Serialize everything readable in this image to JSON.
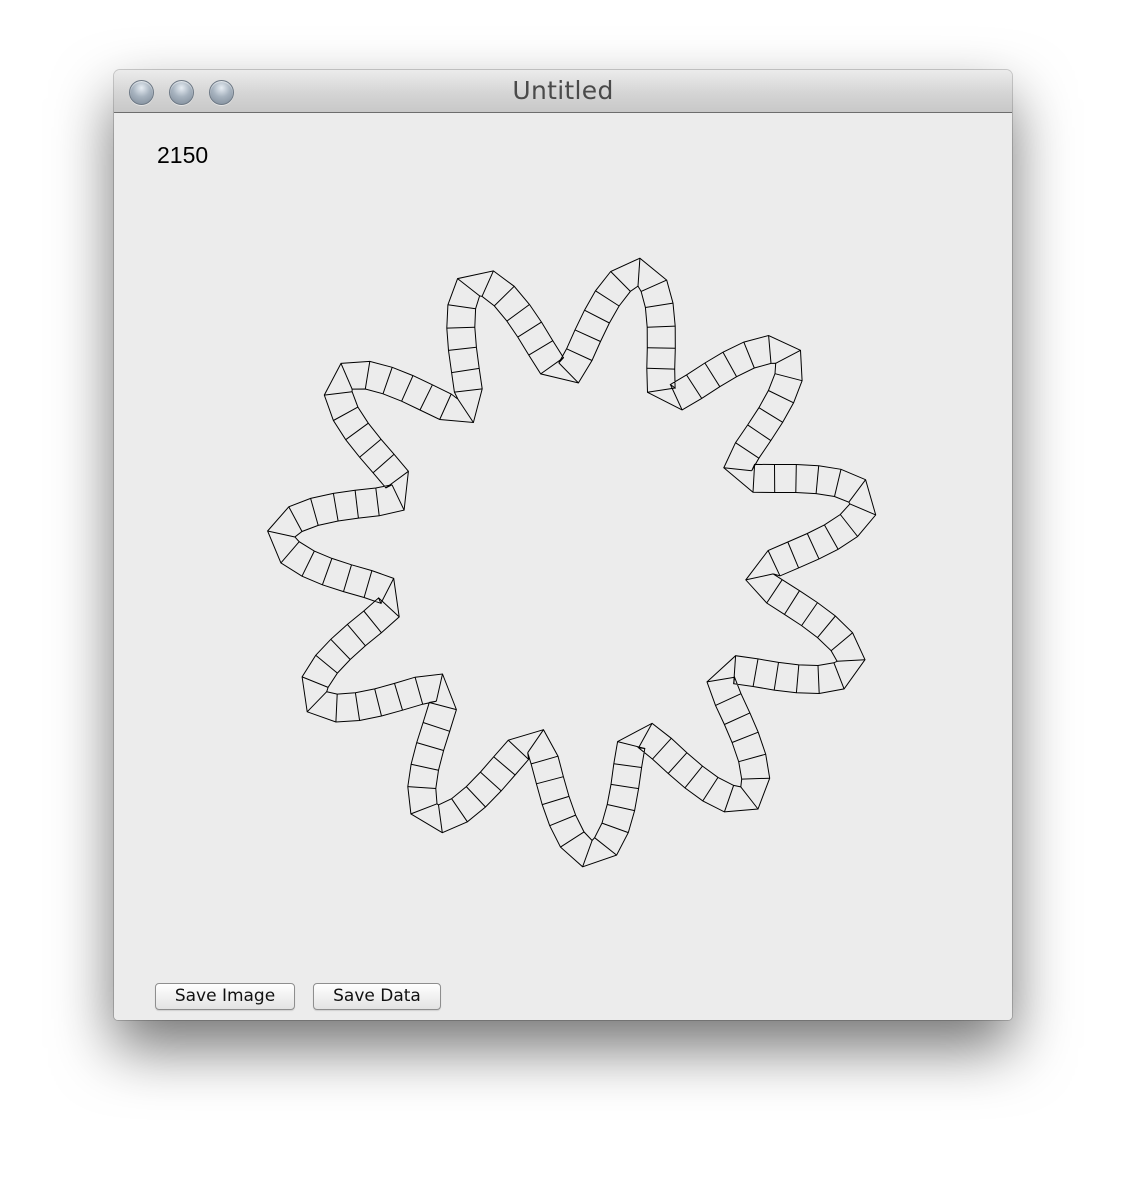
{
  "window": {
    "title": "Untitled"
  },
  "counter": {
    "value": "2150"
  },
  "buttons": {
    "save_image": "Save Image",
    "save_data": "Save Data"
  },
  "icons": {
    "close": "close-icon",
    "minimize": "minimize-icon",
    "zoom": "zoom-icon"
  },
  "drawing": {
    "stroke_color": "#000000",
    "background_color": "#ececec",
    "lobes": 11,
    "segments": 140
  }
}
